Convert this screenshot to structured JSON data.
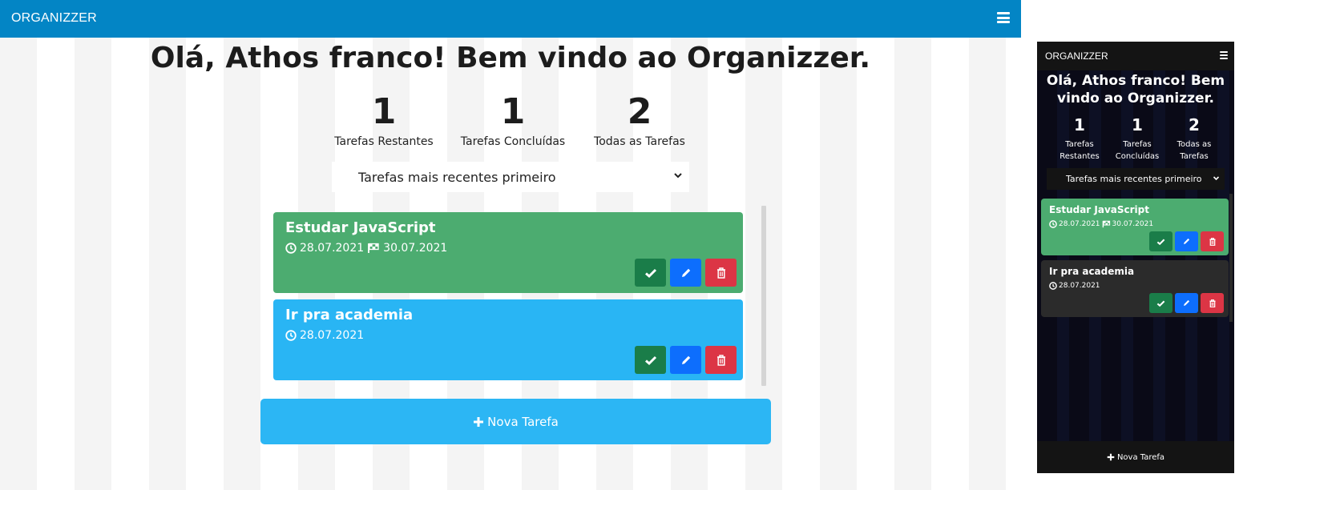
{
  "light": {
    "brand": "ORGANIZZER",
    "greeting": "Olá, Athos franco! Bem vindo ao Organizzer.",
    "stats": [
      {
        "value": "1",
        "label": "Tarefas Restantes"
      },
      {
        "value": "1",
        "label": "Tarefas Concluídas"
      },
      {
        "value": "2",
        "label": "Todas as Tarefas"
      }
    ],
    "sort": {
      "selected": "Tarefas mais recentes primeiro"
    },
    "tasks": [
      {
        "title": "Estudar JavaScript",
        "created": "28.07.2021",
        "due": "30.07.2021",
        "color": "#4cac70"
      },
      {
        "title": "Ir pra academia",
        "created": "28.07.2021",
        "color": "#29b5f4"
      }
    ],
    "new_task": "Nova Tarefa"
  },
  "dark": {
    "brand": "ORGANIZZER",
    "greeting": "Olá, Athos franco! Bem vindo ao Organizzer.",
    "stats": [
      {
        "value": "1",
        "label": "Tarefas Restantes"
      },
      {
        "value": "1",
        "label": "Tarefas Concluídas"
      },
      {
        "value": "2",
        "label": "Todas as Tarefas"
      }
    ],
    "sort": {
      "selected": "Tarefas mais recentes primeiro"
    },
    "tasks": [
      {
        "title": "Estudar JavaScript",
        "created": "28.07.2021",
        "due": "30.07.2021",
        "color": "#4cac70"
      },
      {
        "title": "Ir pra academia",
        "created": "28.07.2021",
        "color": "#2b2b2b"
      }
    ],
    "new_task": "Nova Tarefa"
  },
  "colors": {
    "navbar_light": "#0385c5",
    "navbar_dark": "#141414",
    "success_button": "#1a7d49",
    "edit_button": "#0d6efd",
    "delete_button": "#dc3545",
    "new_task_button": "#2cb6f4"
  },
  "icons": [
    "hamburger-menu-icon",
    "clock-icon",
    "checkered-flag-icon",
    "check-icon",
    "pencil-icon",
    "trash-icon",
    "plus-icon",
    "chevron-down-icon"
  ]
}
